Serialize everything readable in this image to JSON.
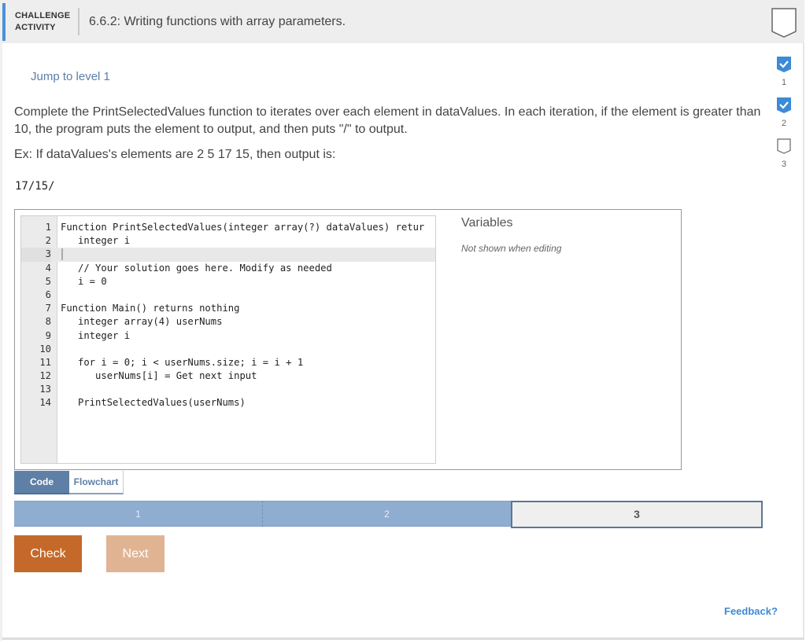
{
  "header": {
    "activity_label_line1": "CHALLENGE",
    "activity_label_line2": "ACTIVITY",
    "title": "6.6.2: Writing functions with array parameters.",
    "bookmark_icon": "bookmark-outline-icon"
  },
  "jump_link": "Jump to level 1",
  "levels": [
    {
      "number": "1",
      "status": "completed",
      "icon": "check-badge-icon"
    },
    {
      "number": "2",
      "status": "completed",
      "icon": "check-badge-icon"
    },
    {
      "number": "3",
      "status": "incomplete",
      "icon": "empty-badge-icon"
    }
  ],
  "instructions": {
    "description": "Complete the PrintSelectedValues function to iterates over each element in dataValues. In each iteration, if the element is greater than 10, the program puts the element to output, and then puts \"/\" to output.",
    "example": "Ex: If dataValues's elements are 2 5 17 15, then output is:",
    "example_output": "17/15/"
  },
  "editor": {
    "lines": [
      {
        "n": "1",
        "text": "Function PrintSelectedValues(integer array(?) dataValues) retur"
      },
      {
        "n": "2",
        "text": "   integer i"
      },
      {
        "n": "3",
        "text": ""
      },
      {
        "n": "4",
        "text": "   // Your solution goes here. Modify as needed"
      },
      {
        "n": "5",
        "text": "   i = 0"
      },
      {
        "n": "6",
        "text": ""
      },
      {
        "n": "7",
        "text": "Function Main() returns nothing"
      },
      {
        "n": "8",
        "text": "   integer array(4) userNums"
      },
      {
        "n": "9",
        "text": "   integer i"
      },
      {
        "n": "10",
        "text": ""
      },
      {
        "n": "11",
        "text": "   for i = 0; i < userNums.size; i = i + 1"
      },
      {
        "n": "12",
        "text": "      userNums[i] = Get next input"
      },
      {
        "n": "13",
        "text": ""
      },
      {
        "n": "14",
        "text": "   PrintSelectedValues(userNums)"
      }
    ],
    "active_line": 3
  },
  "variables": {
    "title": "Variables",
    "note": "Not shown when editing"
  },
  "tabs": [
    {
      "label": "Code",
      "active": true
    },
    {
      "label": "Flowchart",
      "active": false
    }
  ],
  "progress": [
    {
      "label": "1",
      "state": "done"
    },
    {
      "label": "2",
      "state": "done"
    },
    {
      "label": "3",
      "state": "current"
    }
  ],
  "buttons": {
    "check": "Check",
    "next": "Next"
  },
  "feedback": "Feedback?",
  "colors": {
    "accent_blue": "#3d8ad6",
    "check_orange": "#c4692a",
    "next_disabled": "#e0b493",
    "progress_done": "#8fadd1",
    "tab_active": "#5f80a6"
  }
}
